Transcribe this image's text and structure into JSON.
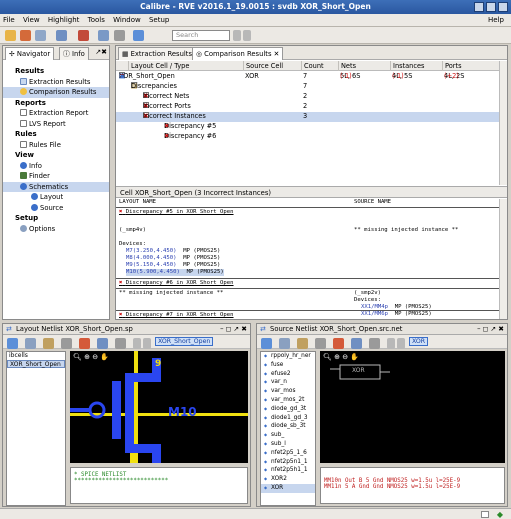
{
  "window": {
    "title": "Calibre - RVE v2016.1_19.0015 : svdb XOR_Short_Open"
  },
  "menu": [
    "File",
    "View",
    "Highlight",
    "Tools",
    "Window",
    "Setup"
  ],
  "menu_help": "Help",
  "toolbar": {
    "search_placeholder": "Search"
  },
  "left_tabs": {
    "navigator": "Navigator",
    "info": "Info"
  },
  "nav": {
    "results_hdr": "Results",
    "extraction_results": "Extraction Results",
    "comparison_results": "Comparison Results",
    "reports_hdr": "Reports",
    "extraction_report": "Extraction Report",
    "lvs_report": "LVS Report",
    "rules_hdr": "Rules",
    "rules_file": "Rules File",
    "view_hdr": "View",
    "info": "Info",
    "finder": "Finder",
    "schematics": "Schematics",
    "layout": "Layout",
    "source": "Source",
    "setup_hdr": "Setup",
    "options": "Options"
  },
  "result_tabs": {
    "extraction": "Extraction Results",
    "comparison": "Comparison Results"
  },
  "table": {
    "headers": [
      "Layout Cell / Type",
      "Source Cell",
      "Count",
      "Nets",
      "Instances",
      "Ports"
    ],
    "rows": [
      {
        "name": "XOR_Short_Open",
        "source": "XOR",
        "count": "7",
        "nets": "5L, 6S",
        "nets_diff": "(-1)",
        "inst": "4L, 5S",
        "inst_diff": "(-1)",
        "ports": "4L, 2S",
        "ports_diff": "(+2)"
      },
      {
        "name": "Discrepancies",
        "count": "7"
      },
      {
        "name": "Incorrect Nets",
        "count": "2"
      },
      {
        "name": "Incorrect Ports",
        "count": "2"
      },
      {
        "name": "Incorrect Instances",
        "count": "3"
      },
      {
        "name": "Discrepancy #5"
      },
      {
        "name": "Discrepancy #6"
      }
    ]
  },
  "cell_header": "Cell XOR_Short_Open (3 Incorrect Instances)",
  "report": {
    "col_layout": "LAYOUT NAME",
    "col_source": "SOURCE NAME",
    "d5_title": "Discrepancy #5 in XOR_Short_Open",
    "d5_cell": "(_smp4v)",
    "d5_missing": "** missing injected instance **",
    "devices": "Devices:",
    "dev_lines": [
      {
        "id": "M7",
        "coord": "(3.250,4.450)",
        "type": "MP (PMOS25)"
      },
      {
        "id": "M8",
        "coord": "(4.000,4.450)",
        "type": "MP (PMOS25)"
      },
      {
        "id": "M9",
        "coord": "(5.150,4.450)",
        "type": "MP (PMOS25)"
      },
      {
        "id": "M10",
        "coord": "(5.900,4.450)",
        "type": "MP (PMOS25)"
      }
    ],
    "d6_title": "Discrepancy #6 in XOR_Short_Open",
    "d6_missing": "** missing injected instance **",
    "d6_cell": "(_smp2v)",
    "d6_devices": "Devices:",
    "d6_dev_lines": [
      {
        "id": "XX1/MM4p",
        "type": "MP (PMOS25)"
      },
      {
        "id": "XX1/MM6p",
        "type": "MP (PMOS25)"
      }
    ],
    "d7_title": "Discrepancy #7 in XOR_Short_Open"
  },
  "layout_panel": {
    "title": "Layout Netlist XOR_Short_Open.sp",
    "chip": "XOR_Short_Open",
    "cells": [
      "ibcells",
      "XOR_Short_Open"
    ],
    "label_9": "9",
    "label_m10": "M10",
    "netlist_line1": "* SPICE NETLIST",
    "netlist_line2": "***************************"
  },
  "source_panel": {
    "title": "Source Netlist XOR_Short_Open.src.net",
    "chip": "XOR",
    "cells": [
      "rppoly_hr_ner",
      "fuse",
      "efuse2",
      "var_n",
      "var_mos",
      "var_mos_2t",
      "diode_gd_3t",
      "diode1_gd_3",
      "diode_sb_3t",
      "sub_",
      "sub_l",
      "nfet2p5_1_6",
      "nfet2p5n1_1",
      "nfet2p5h1_1",
      "XOR2",
      "XOR"
    ],
    "sch_label": "XOR",
    "netlist_line1": "MM10n Out B 5 Gnd NMOS25 w=1.5u l=25E-9",
    "netlist_line2": "MM11n 5 A Gnd Gnd NMOS25 w=1.5u l=25E-9"
  },
  "colors": {
    "accent": "#3d6fb8",
    "discrepancy": "#d01010",
    "layout_metal": "#2a46f0",
    "layout_poly": "#f0e010"
  }
}
